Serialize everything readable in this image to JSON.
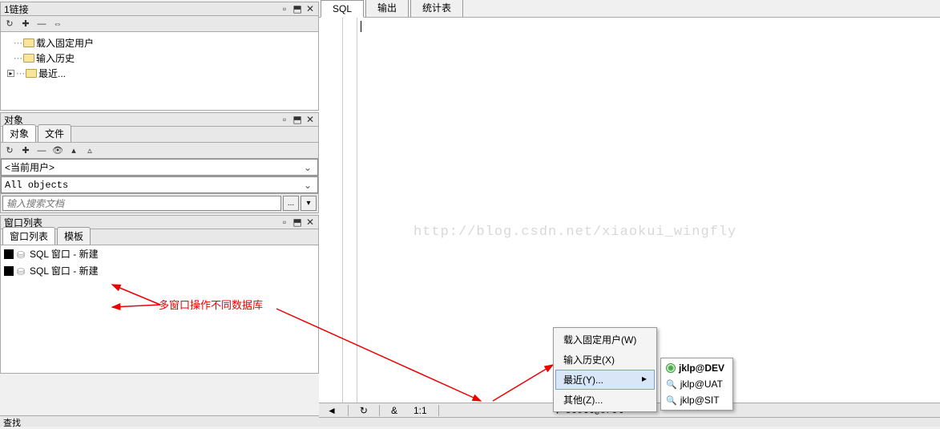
{
  "panels": {
    "link": {
      "title": "1链接"
    },
    "object": {
      "title": "对象"
    },
    "windowlist": {
      "title": "窗口列表"
    }
  },
  "tree": {
    "items": [
      {
        "label": "载入固定用户"
      },
      {
        "label": "输入历史"
      },
      {
        "label": "最近..."
      }
    ]
  },
  "object_tabs": [
    {
      "label": "对象",
      "active": true
    },
    {
      "label": "文件",
      "active": false
    }
  ],
  "dropdowns": {
    "current_user": "<当前用户>",
    "all_objects": "All objects"
  },
  "search": {
    "placeholder": "输入搜索文档",
    "btn": "..."
  },
  "windowlist_tabs": [
    {
      "label": "窗口列表",
      "active": true
    },
    {
      "label": "模板",
      "active": false
    }
  ],
  "window_items": [
    {
      "label": "SQL 窗口 - 新建"
    },
    {
      "label": "SQL 窗口 - 新建"
    }
  ],
  "editor_tabs": [
    {
      "label": "SQL",
      "active": true
    },
    {
      "label": "输出",
      "active": false
    },
    {
      "label": "统计表",
      "active": false
    }
  ],
  "watermark": "http://blog.csdn.net/xiaokui_wingfly",
  "context_menu": {
    "items": [
      {
        "label": "载入固定用户(W)"
      },
      {
        "label": "输入历史(X)"
      },
      {
        "label": "最近(Y)...",
        "highlight": true,
        "arrow": "▸"
      },
      {
        "label": "其他(Z)..."
      }
    ]
  },
  "submenu": {
    "items": [
      {
        "label": "jklp@DEV",
        "bold": true,
        "icon": "throbber"
      },
      {
        "label": "jklp@UAT",
        "icon": "mag"
      },
      {
        "label": "jklp@SIT",
        "icon": "mag"
      }
    ]
  },
  "status": {
    "refresh": "↻",
    "and": "&",
    "pos": "1:1",
    "conn_arrow": "▼",
    "conn": "scott@orcl"
  },
  "bottom_strip": "查找",
  "annotation": "多窗口操作不同数据库"
}
